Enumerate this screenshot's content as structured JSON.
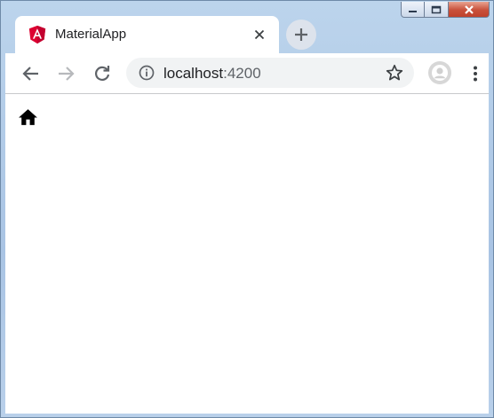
{
  "window": {
    "caption_buttons": [
      "minimize",
      "maximize",
      "close"
    ]
  },
  "tab": {
    "title": "MaterialApp",
    "favicon": "angular-logo-icon"
  },
  "toolbar": {
    "url_host": "localhost",
    "url_port": ":4200"
  },
  "icons": {
    "home": "home-icon"
  },
  "colors": {
    "frame": "#a9c4e4",
    "angular_red": "#dd0031",
    "omnibox_bg": "#f1f3f4",
    "close_button": "#c8503a"
  }
}
